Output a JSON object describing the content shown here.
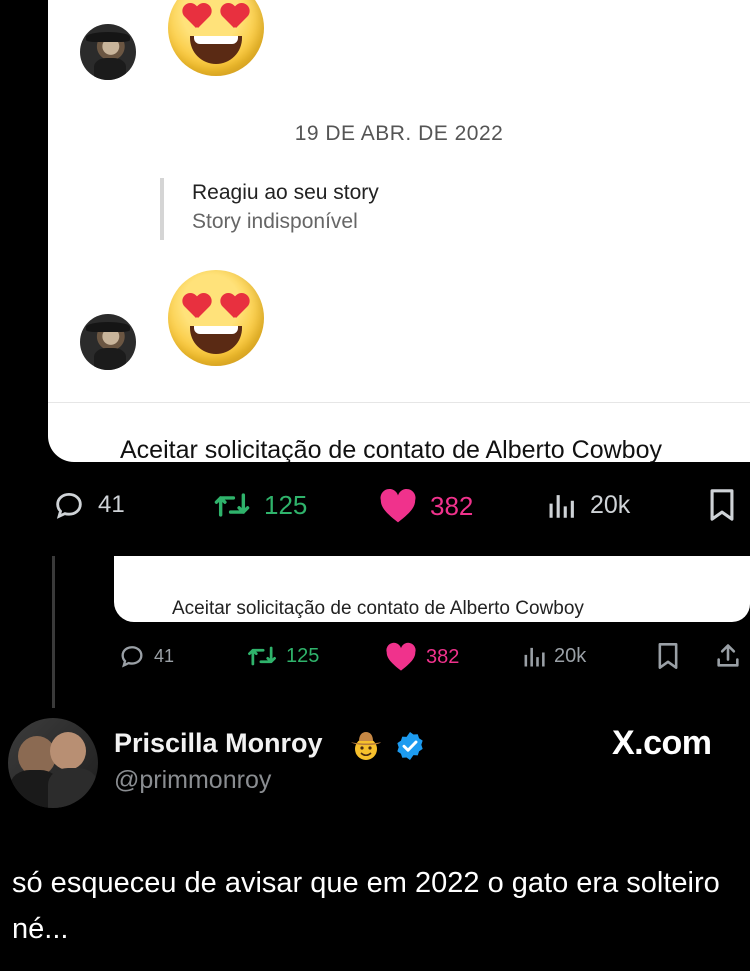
{
  "dm": {
    "date": "19 DE ABR. DE 2022",
    "story_reply_title": "Reagiu ao seu story",
    "story_reply_status": "Story indisponível",
    "accept_text": "Aceitar solicitação de contato de Alberto Cowboy"
  },
  "actions_main": {
    "replies": "41",
    "retweets": "125",
    "likes": "382",
    "views": "20k"
  },
  "dm2": {
    "accept_text": "Aceitar solicitação de contato de Alberto Cowboy"
  },
  "actions_small": {
    "replies": "41",
    "retweets": "125",
    "likes": "382",
    "views": "20k"
  },
  "tweet": {
    "author_name": "Priscilla Monroy",
    "author_handle": "@primmonroy",
    "brand": "X.com",
    "text": "só esqueceu de avisar que em 2022 o gato era solteiro né..."
  },
  "icons": {
    "reply": "reply-icon",
    "retweet": "retweet-icon",
    "like": "heart-icon",
    "views": "views-icon",
    "bookmark": "bookmark-icon",
    "share": "share-icon",
    "verified": "verified-badge-icon",
    "cowboy": "cowboy-emoji-icon",
    "reaction": "heart-eyes-emoji"
  },
  "colors": {
    "background": "#000000",
    "card": "#ffffff",
    "retweet": "#2fb36b",
    "like": "#f0328c",
    "muted": "#9aa0a6",
    "verified": "#1d9bf0"
  }
}
